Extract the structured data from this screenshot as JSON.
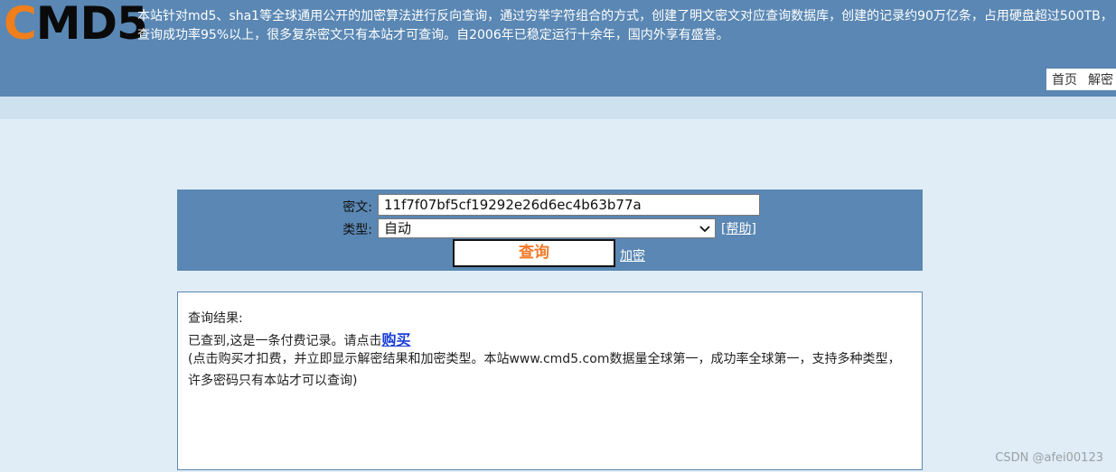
{
  "header": {
    "logo": {
      "first_letter": "C",
      "rest": "MD5"
    },
    "intro": "本站针对md5、sha1等全球通用公开的加密算法进行反向查询，通过穷举字符组合的方式，创建了明文密文对应查询数据库，创建的记录约90万亿条，占用硬盘超过500TB，查询成功率95%以上，很多复杂密文只有本站才可查询。自2006年已稳定运行十余年，国内外享有盛誉。",
    "nav": [
      "首页",
      "解密"
    ]
  },
  "form": {
    "cipher_label": "密文:",
    "cipher_value": "11f7f07bf5cf19292e26d6ec4b63b77a",
    "type_label": "类型:",
    "type_value": "自动",
    "help_link": "[帮助]",
    "query_button": "查询",
    "encrypt_link": "加密"
  },
  "result": {
    "title": "查询结果:",
    "line_prefix": "已查到,这是一条付费记录。请点击",
    "buy_link": "购买",
    "note": "(点击购买才扣费，并立即显示解密结果和加密类型。本站www.cmd5.com数据量全球第一，成功率全球第一，支持多种类型，许多密码只有本站才可以查询)"
  },
  "watermark": "CSDN @afei00123",
  "colors": {
    "header_bg": "#5a87b3",
    "logo_accent": "#f07f1b",
    "query_text": "#f07a2a",
    "buy_link": "#1a3fd6",
    "page_bg": "#e0edf6"
  }
}
